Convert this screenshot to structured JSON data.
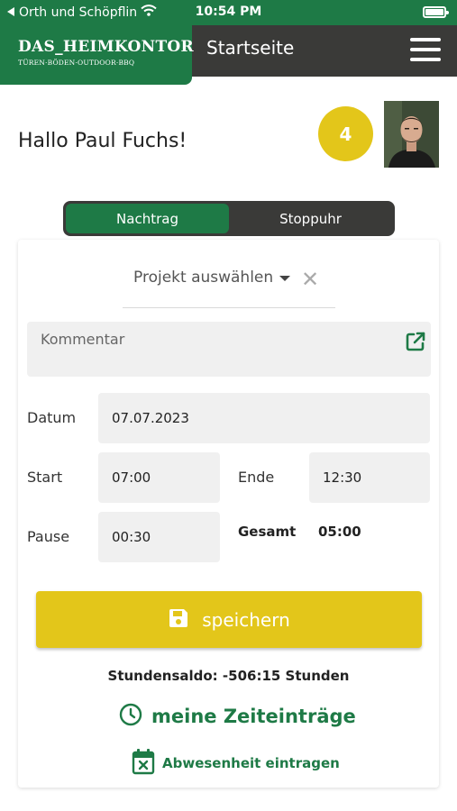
{
  "statusbar": {
    "carrier": "Orth und Schöpflin",
    "time": "10:54 PM"
  },
  "header": {
    "logo_title": "DAS_HEIMKONTOR",
    "logo_subtitle": "TÜREN·BÖDEN·OUTDOOR·BBQ",
    "page_title": "Startseite",
    "menu_icon": "hamburger-menu-icon"
  },
  "greeting": {
    "text": "Hallo Paul Fuchs!",
    "badge_count": "4"
  },
  "tabs": [
    {
      "label": "Nachtrag",
      "active": true
    },
    {
      "label": "Stoppuhr",
      "active": false
    }
  ],
  "form": {
    "project_placeholder": "Projekt auswählen",
    "clear_symbol": "✕",
    "comment_placeholder": "Kommentar",
    "date_label": "Datum",
    "date_value": "07.07.2023",
    "start_label": "Start",
    "start_value": "07:00",
    "end_label": "Ende",
    "end_value": "12:30",
    "pause_label": "Pause",
    "pause_value": "00:30",
    "total_label": "Gesamt",
    "total_value": "05:00"
  },
  "actions": {
    "save_label": "speichern",
    "saldo_text": "Stundensaldo: -506:15 Stunden",
    "entries_label": "meine Zeiteinträge",
    "absence_label": "Abwesenheit eintragen"
  },
  "colors": {
    "brand_green": "#1e7a46",
    "header_dark": "#3a3a38",
    "accent_yellow": "#e3c61a",
    "field_grey": "#f0f0f0"
  }
}
